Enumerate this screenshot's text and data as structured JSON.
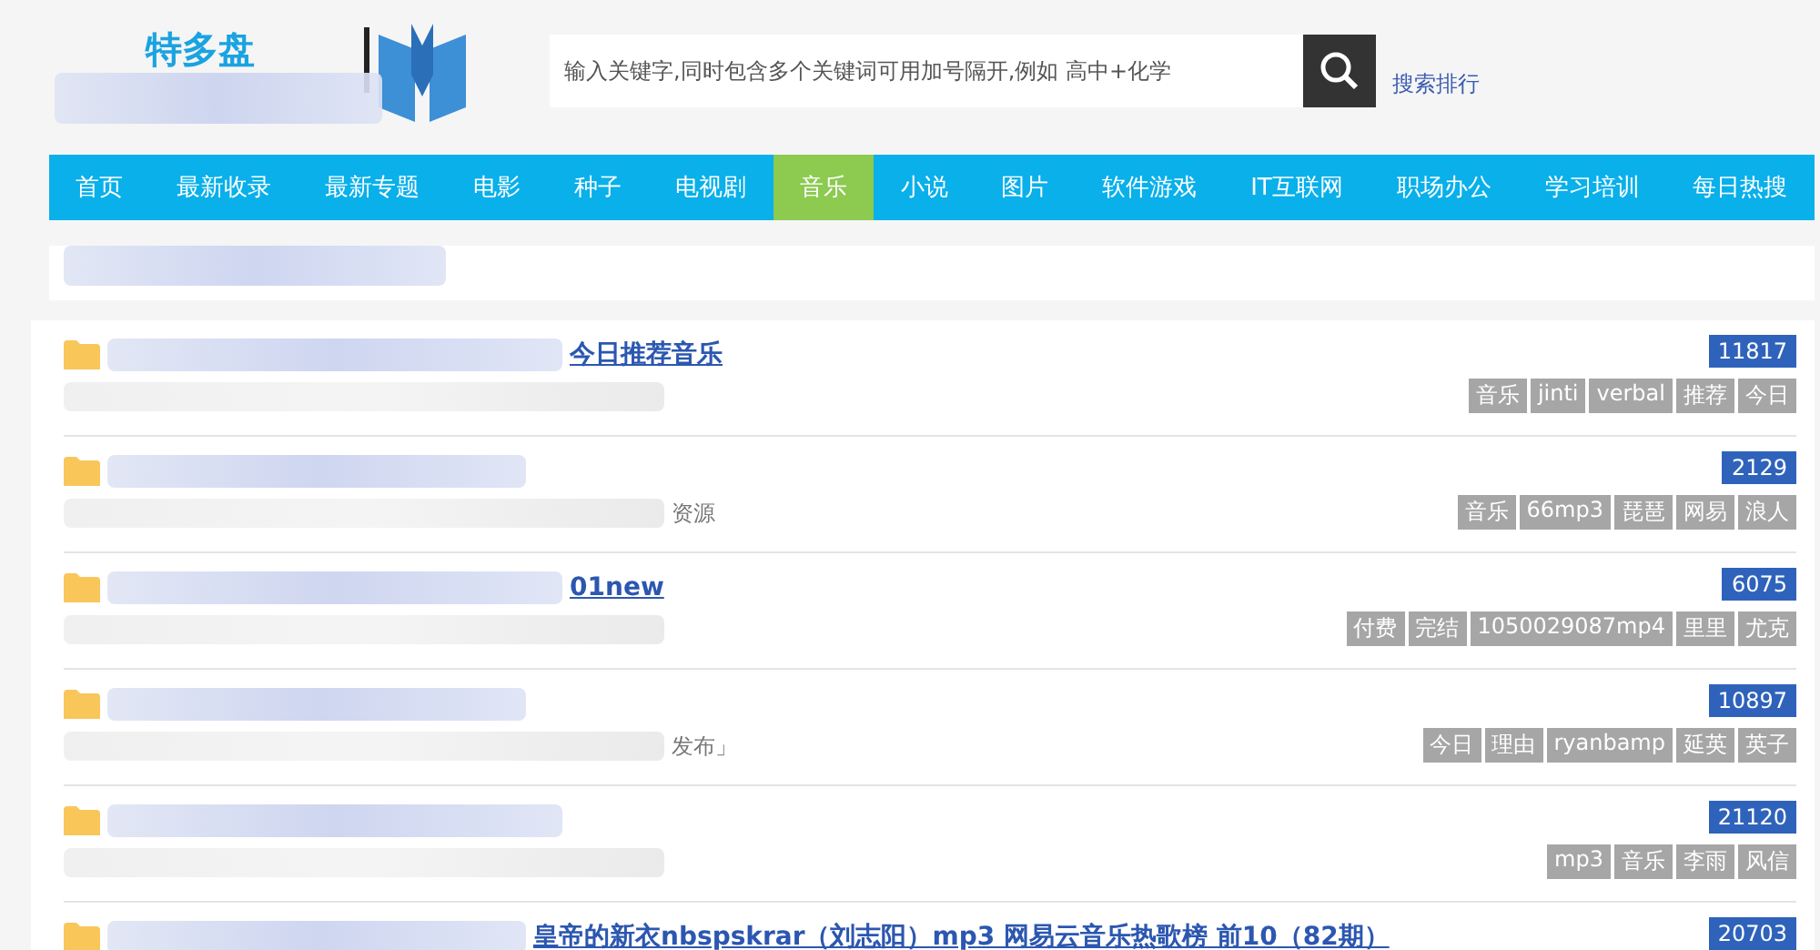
{
  "header": {
    "logo_text": "特多盘",
    "search": {
      "placeholder": "输入关键字,同时包含多个关键词可用加号隔开,例如 高中+化学"
    },
    "ranking_link": "搜索排行"
  },
  "nav": [
    {
      "label": "首页",
      "selected": false
    },
    {
      "label": "最新收录",
      "selected": false
    },
    {
      "label": "最新专题",
      "selected": false
    },
    {
      "label": "电影",
      "selected": false
    },
    {
      "label": "种子",
      "selected": false
    },
    {
      "label": "电视剧",
      "selected": false
    },
    {
      "label": "音乐",
      "selected": true
    },
    {
      "label": "小说",
      "selected": false
    },
    {
      "label": "图片",
      "selected": false
    },
    {
      "label": "软件游戏",
      "selected": false
    },
    {
      "label": "IT互联网",
      "selected": false
    },
    {
      "label": "职场办公",
      "selected": false
    },
    {
      "label": "学习培训",
      "selected": false
    },
    {
      "label": "每日热搜",
      "selected": false
    }
  ],
  "results": [
    {
      "title": "今日推荐音乐",
      "count": "11817",
      "tags": [
        "音乐",
        "jinti",
        "verbal",
        "推荐",
        "今日"
      ]
    },
    {
      "description": "资源",
      "count": "2129",
      "tags": [
        "音乐",
        "66mp3",
        "琵琶",
        "网易",
        "浪人"
      ]
    },
    {
      "title": "01new",
      "count": "6075",
      "tags": [
        "付费",
        "完结",
        "1050029087mp4",
        "里里",
        "尤克"
      ]
    },
    {
      "description": "发布」",
      "count": "10897",
      "tags": [
        "今日",
        "理由",
        "ryanbamp",
        "延英",
        "英子"
      ]
    },
    {
      "count": "21120",
      "tags": [
        "mp3",
        "音乐",
        "李雨",
        "风信"
      ]
    },
    {
      "title": "皇帝的新衣nbspskrar（刘志阳）mp3 网易云音乐热歌榜 前10（82期）",
      "count": "20703"
    }
  ]
}
